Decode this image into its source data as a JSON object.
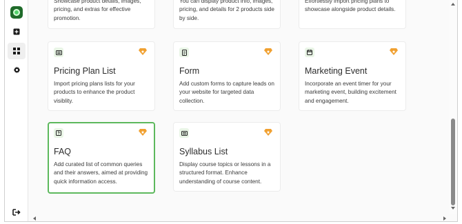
{
  "colors": {
    "accent_green": "#5cb85c",
    "pro_icon_orange": "#f0a030",
    "logo_green": "#1f6b2a"
  },
  "sidebar": {
    "items": [
      {
        "icon": "logo-icon"
      },
      {
        "icon": "plus-square-icon"
      },
      {
        "icon": "grid-icon",
        "active": true
      },
      {
        "icon": "gear-icon"
      },
      {
        "icon": "logout-icon"
      }
    ]
  },
  "top_row": [
    {
      "desc": "Showcase product details, images, pricing, and extras for effective promotion."
    },
    {
      "desc": "You can display product info, images, pricing, and details for 2 products side by side."
    },
    {
      "desc": "Effortlessly import pricing plans to showcase alongside product details."
    }
  ],
  "cards": [
    {
      "title": "Pricing Plan List",
      "desc": "Import pricing plans lists for your products to enhance the product visiblity.",
      "icon": "list-card-icon"
    },
    {
      "title": "Form",
      "desc": "Add custom forms to capture leads on your website for targeted data collection.",
      "icon": "form-icon"
    },
    {
      "title": "Marketing Event",
      "desc": "Incorporate an event timer for your marketing event, building excitement and engagement.",
      "icon": "calendar-icon"
    },
    {
      "title": "FAQ",
      "desc": "Add curated list of common queries and their answers, aimed at providing quick information access.",
      "icon": "question-icon",
      "selected": true
    },
    {
      "title": "Syllabus List",
      "desc": "Display course topics or lessons in a structured format. Enhance understanding of course content.",
      "icon": "list-card-icon"
    }
  ]
}
